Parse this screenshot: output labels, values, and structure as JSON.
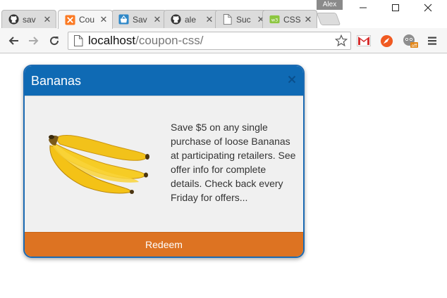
{
  "browser": {
    "profile_name": "Alex",
    "tabs": [
      {
        "label": "sav",
        "icon": "github-icon"
      },
      {
        "label": "Cou",
        "icon": "xampp-icon",
        "active": true
      },
      {
        "label": "Sav",
        "icon": "shopping-basket-icon"
      },
      {
        "label": "ale",
        "icon": "github-icon"
      },
      {
        "label": "Suc",
        "icon": "page-icon"
      },
      {
        "label": "CSS",
        "icon": "css-icon"
      }
    ],
    "address": {
      "host": "localhost",
      "path": "/coupon-css/"
    },
    "extensions": [
      "gmail-icon",
      "compass-icon",
      "tampermonkey-icon",
      "menu-icon"
    ]
  },
  "coupon": {
    "title": "Bananas",
    "image": "bananas-image",
    "description": "Save $5 on any single purchase of loose Bananas at participating retailers. See offer info for complete details. Check back every Friday for offers...",
    "button_label": "Redeem",
    "colors": {
      "header": "#0f6ab4",
      "border": "#1b6ab3",
      "button": "#dd7322",
      "body": "#f0f0f0"
    }
  }
}
